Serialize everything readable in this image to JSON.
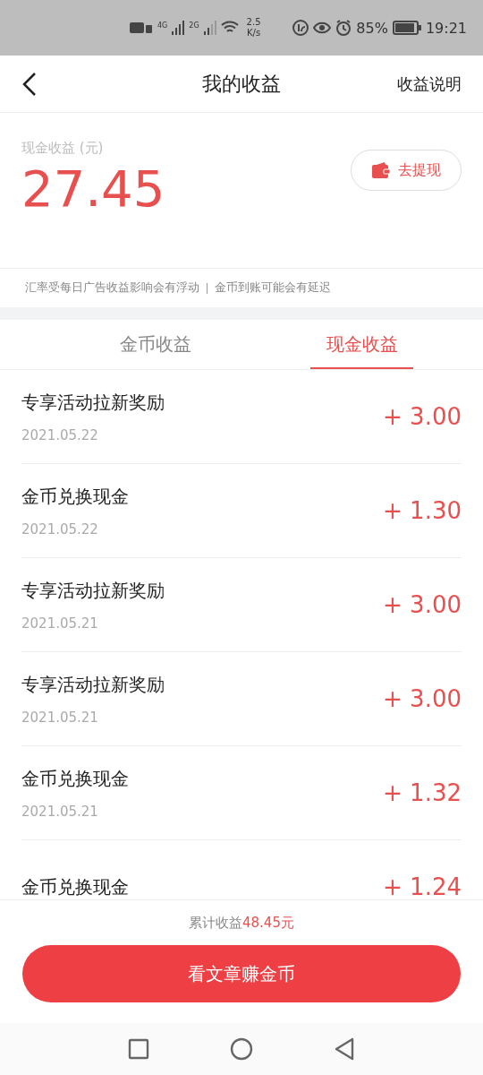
{
  "status_bar": {
    "network_1": "4G",
    "network_2": "2G",
    "speed_value": "2.5",
    "speed_unit": "K/s",
    "battery": "85%",
    "time": "19:21"
  },
  "header": {
    "title": "我的收益",
    "action": "收益说明"
  },
  "summary": {
    "label": "现金收益 (元)",
    "amount": "27.45",
    "withdraw_button": "去提现"
  },
  "notice": [
    "汇率受每日广告收益影响会有浮动",
    "金币到账可能会有延迟"
  ],
  "tabs": [
    {
      "label": "金币收益",
      "selected": false
    },
    {
      "label": "现金收益",
      "selected": true
    }
  ],
  "records": [
    {
      "title": "专享活动拉新奖励",
      "date": "2021.05.22",
      "amount": "+ 3.00"
    },
    {
      "title": "金币兑换现金",
      "date": "2021.05.22",
      "amount": "+ 1.30"
    },
    {
      "title": "专享活动拉新奖励",
      "date": "2021.05.21",
      "amount": "+ 3.00"
    },
    {
      "title": "专享活动拉新奖励",
      "date": "2021.05.21",
      "amount": "+ 3.00"
    },
    {
      "title": "金币兑换现金",
      "date": "2021.05.21",
      "amount": "+ 1.32"
    },
    {
      "title": "金币兑换现金",
      "amount": "+ 1.24"
    }
  ],
  "total": {
    "label": "累计收益",
    "value": "48.45元"
  },
  "action_button": "看文章赚金币"
}
